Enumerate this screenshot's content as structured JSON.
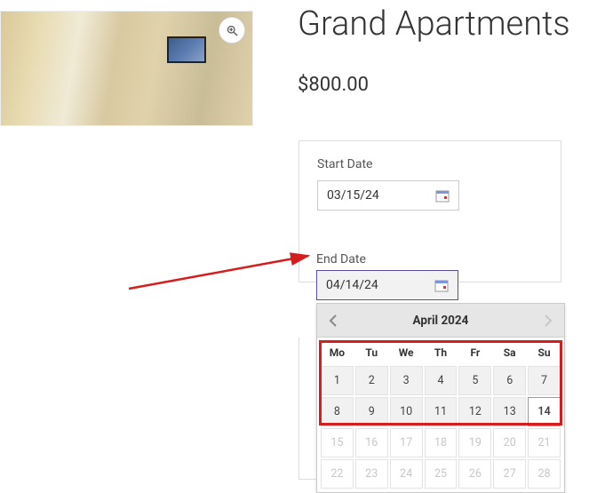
{
  "product": {
    "title": "Grand Apartments",
    "price": "$800.00"
  },
  "booking": {
    "start_label": "Start Date",
    "start_value": "03/15/24",
    "end_label": "End Date",
    "end_value": "04/14/24"
  },
  "calendar": {
    "month_title": "April 2024",
    "dow": [
      "Mo",
      "Tu",
      "We",
      "Th",
      "Fr",
      "Sa",
      "Su"
    ],
    "weeks": [
      [
        {
          "d": "1"
        },
        {
          "d": "2"
        },
        {
          "d": "3"
        },
        {
          "d": "4"
        },
        {
          "d": "5"
        },
        {
          "d": "6"
        },
        {
          "d": "7"
        }
      ],
      [
        {
          "d": "8"
        },
        {
          "d": "9"
        },
        {
          "d": "10"
        },
        {
          "d": "11"
        },
        {
          "d": "12"
        },
        {
          "d": "13"
        },
        {
          "d": "14",
          "sel": true
        }
      ],
      [
        {
          "d": "15",
          "out": true
        },
        {
          "d": "16",
          "out": true
        },
        {
          "d": "17",
          "out": true
        },
        {
          "d": "18",
          "out": true
        },
        {
          "d": "19",
          "out": true
        },
        {
          "d": "20",
          "out": true
        },
        {
          "d": "21",
          "out": true
        }
      ],
      [
        {
          "d": "22",
          "out": true
        },
        {
          "d": "23",
          "out": true
        },
        {
          "d": "24",
          "out": true
        },
        {
          "d": "25",
          "out": true
        },
        {
          "d": "26",
          "out": true
        },
        {
          "d": "27",
          "out": true
        },
        {
          "d": "28",
          "out": true
        }
      ]
    ]
  }
}
